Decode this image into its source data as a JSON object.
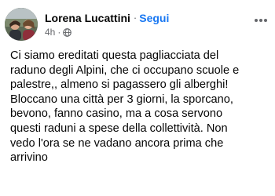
{
  "post": {
    "author": "Lorena Lucattini",
    "separator": "·",
    "follow_label": "Segui",
    "time": "4h",
    "time_separator": "·",
    "audience_icon": "globe-icon",
    "more_icon": "more-options-icon",
    "text": "Ci siamo ereditati questa pagliacciata del\nraduno degli Alpini, che ci occupano scuole e\npalestre,, almeno si pagassero gli alberghi!\nBloccano una città per 3 giorni, la sporcano,\nbevono, fanno casino, ma a cosa servono\nquesti raduni a spese della collettività. Non\nvedo l'ora se ne vadano ancora prima che\narrivino"
  },
  "colors": {
    "link": "#1877f2",
    "secondary_text": "#65676b",
    "primary_text": "#050505",
    "background": "#ffffff"
  }
}
